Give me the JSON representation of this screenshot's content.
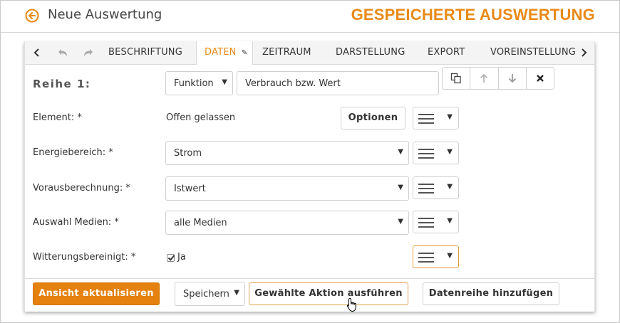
{
  "header": {
    "title": "Neue Auswertung",
    "brand": "GESPEICHERTE AUSWERTUNG",
    "accent_color": "#e98a17"
  },
  "tabs": [
    {
      "label": "BESCHRIFTUNG"
    },
    {
      "label": "DATEN"
    },
    {
      "label": "ZEITRAUM"
    },
    {
      "label": "DARSTELLUNG"
    },
    {
      "label": "EXPORT"
    },
    {
      "label": "VOREINSTELLUNG"
    }
  ],
  "series": {
    "label": "Reihe 1:",
    "type_select": "Funktion",
    "value_input": "Verbrauch bzw. Wert"
  },
  "fields": {
    "element": {
      "label": "Element: *",
      "value": "Offen gelassen",
      "button": "Optionen"
    },
    "energy": {
      "label": "Energiebereich: *",
      "value": "Strom"
    },
    "forecast": {
      "label": "Vorausberechnung: *",
      "value": "Istwert"
    },
    "media": {
      "label": "Auswahl Medien: *",
      "value": "alle Medien"
    },
    "weather": {
      "label": "Witterungsbereinigt: *",
      "checkbox_label": "Ja",
      "checked": true
    }
  },
  "footer": {
    "refresh": "Ansicht aktualisieren",
    "action_select": "Speichern",
    "run_action": "Gewählte Aktion ausführen",
    "add_series": "Datenreihe hinzufügen"
  },
  "icons": {
    "back": "arrow-circle-left-icon",
    "copy": "copy-icon",
    "up": "arrow-up-icon",
    "down": "arrow-down-icon",
    "close": "close-icon",
    "menu": "hamburger-icon",
    "pencil": "pencil-icon"
  }
}
